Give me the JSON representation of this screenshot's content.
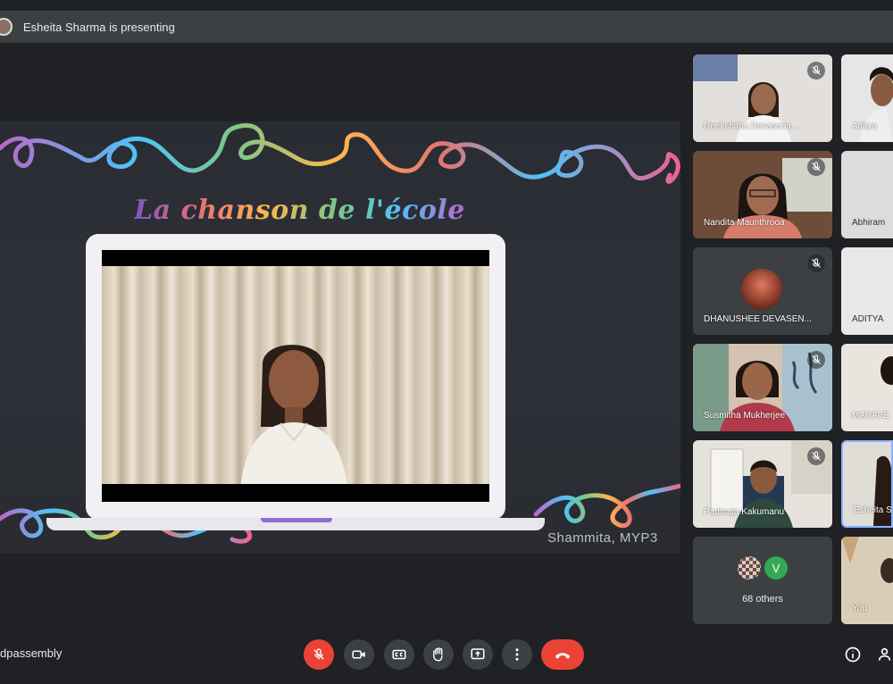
{
  "presenting": {
    "text": "Esheita Sharma is presenting",
    "icon": "presenter-avatar"
  },
  "slide": {
    "title": "La chanson de l'école",
    "caption": "Shammita, MYP3"
  },
  "participants": [
    {
      "name": "Deekshitha Devasena ...",
      "muted": true
    },
    {
      "name": "Aditya",
      "muted": false
    },
    {
      "name": "Nandita Maunthrooa",
      "muted": true
    },
    {
      "name": "Abhiram",
      "muted": false
    },
    {
      "name": "DHANUSHEE DEVASEN...",
      "muted": true
    },
    {
      "name": "ADITYA",
      "muted": false
    },
    {
      "name": "Susmitha Mukherjee",
      "muted": true
    },
    {
      "name": "MAHAVE",
      "muted": false
    },
    {
      "name": "Padmaja Kakumanu",
      "muted": true
    },
    {
      "name": "Esheita S",
      "muted": false
    },
    {
      "name": "68 others",
      "avatar_letter": "V"
    },
    {
      "name": "You",
      "muted": false
    }
  ],
  "controls": {
    "meeting_code": "dpassembly",
    "mic": "mic-off-icon",
    "camera": "camera-icon",
    "captions": "CC",
    "raise_hand": "raise-hand-icon",
    "present": "present-screen-icon",
    "more": "more-options-icon",
    "hangup": "hang-up-icon",
    "info": "info-icon",
    "people": "people-icon"
  },
  "colors": {
    "background": "#202124",
    "tile": "#3c4043",
    "red": "#ea4335",
    "active_border": "#8ab4f8"
  }
}
